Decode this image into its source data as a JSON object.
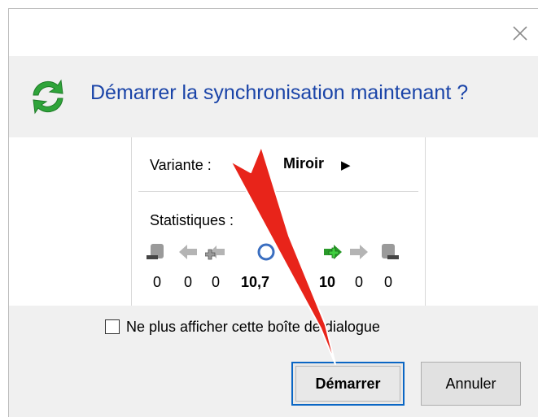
{
  "dialog": {
    "title": "Démarrer la synchronisation maintenant ?",
    "close_icon": "close-icon",
    "sync_icon": "sync-icon"
  },
  "variant": {
    "label": "Variante :",
    "value": "Miroir",
    "arrow_icon": "play-arrow-icon"
  },
  "statistics": {
    "label": "Statistiques :",
    "items": [
      {
        "icon": "delete-left-icon",
        "value": "0"
      },
      {
        "icon": "update-left-icon",
        "value": "0"
      },
      {
        "icon": "create-left-icon",
        "value": "0"
      },
      {
        "icon": "data-icon",
        "value": "10,7"
      },
      {
        "icon": "create-right-icon",
        "value": "10"
      },
      {
        "icon": "update-right-icon",
        "value": "0"
      },
      {
        "icon": "delete-right-icon",
        "value": "0"
      }
    ]
  },
  "checkbox": {
    "label": "Ne plus afficher cette boîte de dialogue",
    "checked": false
  },
  "buttons": {
    "start": "Démarrer",
    "cancel": "Annuler"
  },
  "colors": {
    "title": "#1a44a8",
    "accent_button_border": "#0a66c4",
    "sync_green": "#2fa43a",
    "overlay_arrow": "#e8241a"
  }
}
